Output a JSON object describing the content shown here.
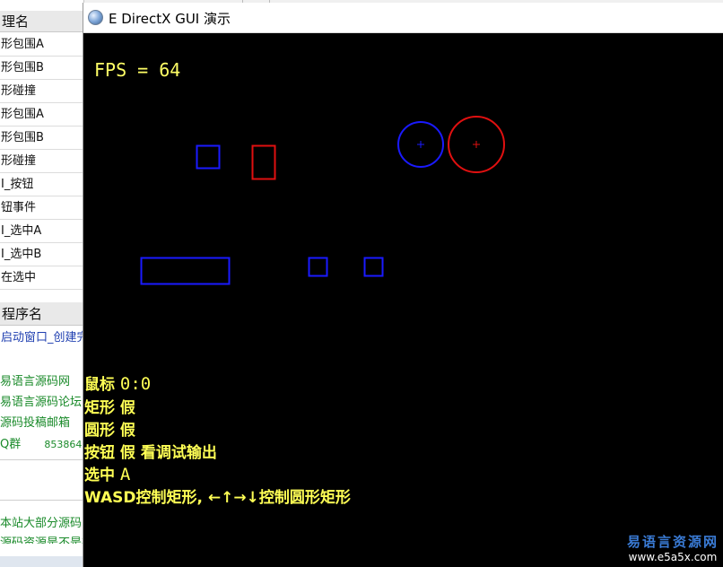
{
  "background_table": {
    "header1": "理名",
    "rows1": [
      "形包围A",
      "形包围B",
      "形碰撞",
      "形包围A",
      "形包围B",
      "形碰撞",
      "I_按钮",
      "钮事件",
      "I_选中A",
      "I_选中B",
      "在选中"
    ],
    "header2": "程序名",
    "row2": "启动窗口_创建完",
    "links": [
      "易语言源码网",
      "易语言源码论坛",
      "源码投稿邮箱",
      "Q群"
    ],
    "qq_number": "853864",
    "bottom_text1": "本站大部分源码",
    "bottom_text2": "源码资源是不是在"
  },
  "window": {
    "title": "E DirectX  GUI 演示",
    "icon": "app-globe-icon"
  },
  "canvas": {
    "fps_text": "FPS = 64",
    "mouse_label": "鼠标",
    "mouse_value": "0:0",
    "rect_label": "矩形",
    "rect_value": "假",
    "circle_label": "圆形",
    "circle_value": "假",
    "button_label": "按钮",
    "button_value": "假",
    "button_hint": "看调试输出",
    "selected_label": "选中",
    "selected_value": "A",
    "controls_text": "WASD控制矩形, ←↑→↓控制圆形矩形",
    "colors": {
      "text": "#ffff55",
      "blue_shape": "#1a1aff",
      "red_shape": "#e01010"
    }
  },
  "watermark": {
    "title": "易语言资源网",
    "url": "www.e5a5x.com"
  }
}
